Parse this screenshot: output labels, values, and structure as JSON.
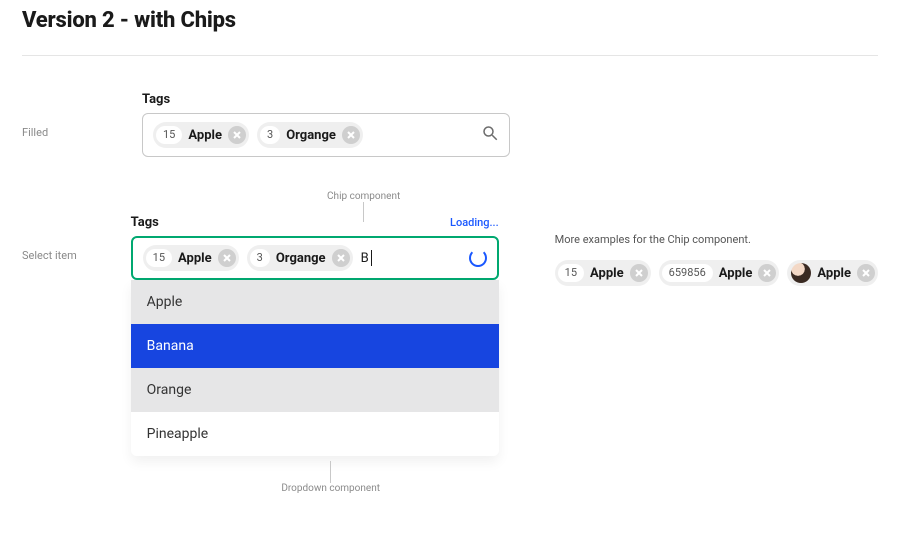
{
  "title": "Version 2 - with Chips",
  "rows": {
    "filled": {
      "label": "Filled"
    },
    "select": {
      "label": "Select item"
    }
  },
  "field_label": "Tags",
  "loading_text": "Loading...",
  "annotations": {
    "chip": "Chip component",
    "dropdown": "Dropdown component"
  },
  "filled_chips": [
    {
      "count": "15",
      "label": "Apple"
    },
    {
      "count": "3",
      "label": "Organge"
    }
  ],
  "select_chips": [
    {
      "count": "15",
      "label": "Apple"
    },
    {
      "count": "3",
      "label": "Organge"
    }
  ],
  "typed": "B",
  "dropdown": [
    {
      "label": "Apple",
      "selected": false
    },
    {
      "label": "Banana",
      "selected": true
    },
    {
      "label": "Orange",
      "selected": false
    },
    {
      "label": "Pineapple",
      "selected": false
    }
  ],
  "examples_caption": "More examples for the Chip component.",
  "example_chips": [
    {
      "count": "15",
      "label": "Apple",
      "kind": "count"
    },
    {
      "count": "659856",
      "label": "Apple",
      "kind": "count"
    },
    {
      "label": "Apple",
      "kind": "avatar"
    }
  ]
}
